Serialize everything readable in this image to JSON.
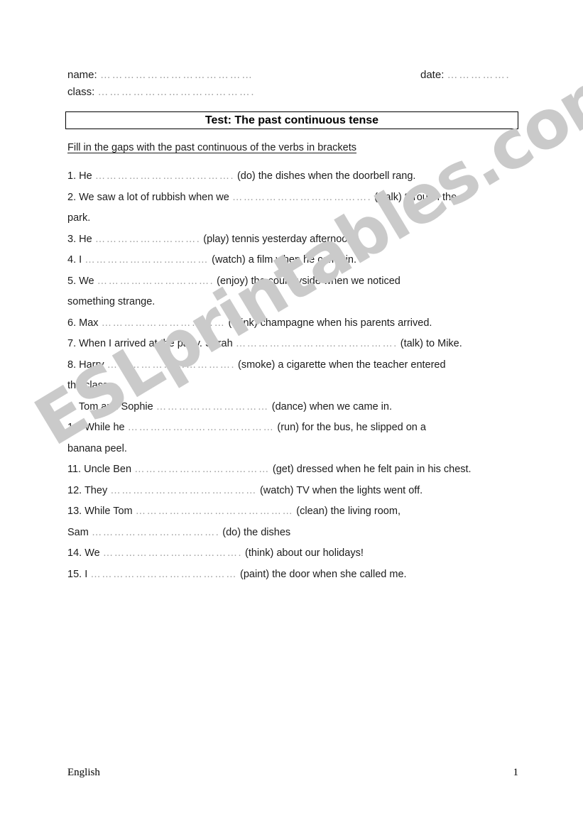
{
  "header": {
    "name_label": "name:",
    "name_dots": "…………………………………",
    "class_label": "class:",
    "class_dots": "………………………………….",
    "date_label": "date:",
    "date_dots": "……………."
  },
  "title": {
    "text": "Test: The past continuous tense"
  },
  "instruction": {
    "text": "Fill in the gaps with the past continuous of the verbs in brackets"
  },
  "watermark": {
    "text": "ESLprintables.com",
    "color": "#cacaca"
  },
  "questions": [
    {
      "number": "1.",
      "before": "He",
      "dots": "……………………………….",
      "after": "(do) the dishes when the doorbell rang."
    },
    {
      "number": "2.",
      "before": "We saw a lot of rubbish when we",
      "dots": "……………………………….",
      "after": "(walk) through the"
    },
    {
      "number": "",
      "before": "park.",
      "dots": "",
      "after": ""
    },
    {
      "number": "3.",
      "before": "He",
      "dots": "……………………….",
      "after": "(play) tennis yesterday afternoon."
    },
    {
      "number": "4.",
      "before": "I",
      "dots": "……………………………",
      "after": "(watch) a film when he came in."
    },
    {
      "number": "5.",
      "before": "We",
      "dots": "………………………….",
      "after": "(enjoy) the countryside when we noticed"
    },
    {
      "number": "",
      "before": "something strange.",
      "dots": "",
      "after": ""
    },
    {
      "number": "6.",
      "before": "Max",
      "dots": "……………………………",
      "after": "(drink) champagne when his parents arrived."
    },
    {
      "number": "7.",
      "before": "When I arrived at the party. Sarah",
      "dots": "…………………………………….",
      "after": "(talk) to Mike."
    },
    {
      "number": "8.",
      "before": "Harry",
      "dots": "…………………………….",
      "after": "(smoke) a cigarette when the teacher entered"
    },
    {
      "number": "",
      "before": "the class.",
      "dots": "",
      "after": ""
    },
    {
      "number": "9.",
      "before": "Tom and Sophie",
      "dots": "…………………………",
      "after": "(dance) when we came in."
    },
    {
      "number": "10.",
      "before": "While he",
      "dots": "…………………………………",
      "after": "(run) for the bus, he slipped on a"
    },
    {
      "number": "",
      "before": "banana peel.",
      "dots": "",
      "after": ""
    },
    {
      "number": "11.",
      "before": "Uncle Ben",
      "dots": "………………………………",
      "after": "(get) dressed when he felt pain in his chest."
    },
    {
      "number": "12.",
      "before": "They",
      "dots": "…………………………………",
      "after": "(watch) TV when the lights went off."
    },
    {
      "number": "13.",
      "before": "While Tom",
      "dots": "……………………………………",
      "after": "(clean)  the living room,"
    },
    {
      "number": "",
      "before": "Sam",
      "dots": "…………………………….",
      "after": "(do) the dishes"
    },
    {
      "number": "14.",
      "before": "We",
      "dots": "……………………………….",
      "after": "(think) about our holidays!"
    },
    {
      "number": "15.",
      "before": "I",
      "dots": "…………………………………",
      "after": "(paint) the door when she called me."
    }
  ],
  "footer": {
    "subject": "English",
    "page_number": "1"
  }
}
